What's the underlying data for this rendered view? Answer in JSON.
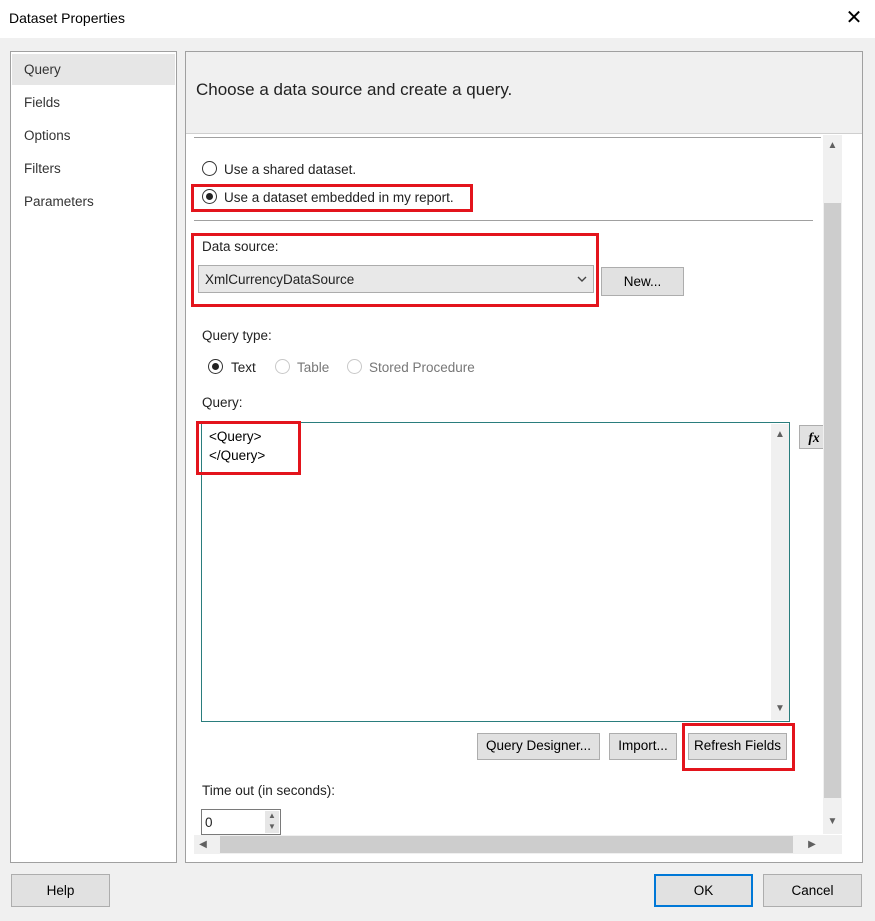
{
  "window": {
    "title": "Dataset Properties",
    "close_glyph": "✕"
  },
  "nav": {
    "items": [
      "Query",
      "Fields",
      "Options",
      "Filters",
      "Parameters"
    ],
    "selected": "Query"
  },
  "panel": {
    "heading": "Choose a data source and create a query.",
    "radio_shared": "Use a shared dataset.",
    "radio_embedded": "Use a dataset embedded in my report.",
    "data_source_label": "Data source:",
    "data_source_value": "XmlCurrencyDataSource",
    "new_button": "New...",
    "query_type_label": "Query type:",
    "query_types": [
      "Text",
      "Table",
      "Stored Procedure"
    ],
    "query_label": "Query:",
    "query_text": "<Query>\n</Query>",
    "fx_glyph": "fx",
    "query_designer_button": "Query Designer...",
    "import_button": "Import...",
    "refresh_fields_button": "Refresh Fields",
    "timeout_label": "Time out (in seconds):",
    "timeout_value": "0"
  },
  "footer": {
    "help": "Help",
    "ok": "OK",
    "cancel": "Cancel"
  },
  "icons": {
    "dropdown": "chevron-down-icon",
    "scroll_up": "up-arrow-icon",
    "scroll_down": "down-arrow-icon",
    "scroll_left": "left-arrow-icon",
    "scroll_right": "right-arrow-icon",
    "expression": "fx-icon"
  },
  "colors": {
    "highlight": "#e3141c",
    "primary_border": "#0078d7",
    "selected_nav": "#e6e6e6"
  }
}
